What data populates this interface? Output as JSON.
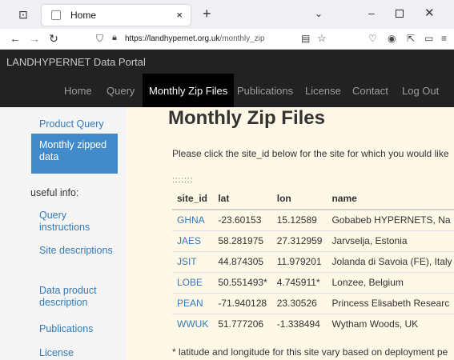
{
  "browser": {
    "tab_title": "Home",
    "tab_close": "×",
    "new_tab": "+",
    "overflow": "⌄",
    "min": "–",
    "close": "✕",
    "url_host": "https://landhypernet.org.uk",
    "url_path": "/monthly_zip",
    "back": "←",
    "forward": "→",
    "reload": "↻"
  },
  "site": {
    "brand": "LANDHYPERNET Data Portal",
    "nav": [
      "Home",
      "Query",
      "Monthly Zip Files",
      "Publications",
      "License",
      "Contact",
      "Log Out"
    ]
  },
  "sidebar": {
    "items": [
      "Product Query",
      "Monthly zipped data",
      "useful info:",
      "Query instructions",
      "Site descriptions",
      "Data product description",
      "Publications",
      "License"
    ]
  },
  "main": {
    "title": "Monthly Zip Files",
    "intro": "Please click the site_id below for the site for which you would like",
    "dots": ":::::::",
    "columns": [
      "site_id",
      "lat",
      "lon",
      "name"
    ],
    "rows": [
      {
        "site_id": "GHNA",
        "lat": "-23.60153",
        "lon": "15.12589",
        "name": "Gobabeb HYPERNETS, Na"
      },
      {
        "site_id": "JAES",
        "lat": "58.281975",
        "lon": "27.312959",
        "name": "Jarvselja, Estonia"
      },
      {
        "site_id": "JSIT",
        "lat": "44.874305",
        "lon": "11.979201",
        "name": "Jolanda di Savoia (FE), Italy"
      },
      {
        "site_id": "LOBE",
        "lat": "50.551493*",
        "lon": "4.745911*",
        "name": "Lonzee, Belgium"
      },
      {
        "site_id": "PEAN",
        "lat": "-71.940128",
        "lon": "23.30526",
        "name": "Princess Elisabeth Researc"
      },
      {
        "site_id": "WWUK",
        "lat": "51.777206",
        "lon": "-1.338494",
        "name": "Wytham Woods, UK"
      }
    ],
    "footnote": "* latitude and longitude for this site vary based on deployment pe"
  },
  "colors": {
    "header_bg": "#222222",
    "active_nav_bg": "#000000",
    "link": "#337ab7",
    "sidebar_active": "#428bca",
    "main_bg": "#fff8e7"
  }
}
